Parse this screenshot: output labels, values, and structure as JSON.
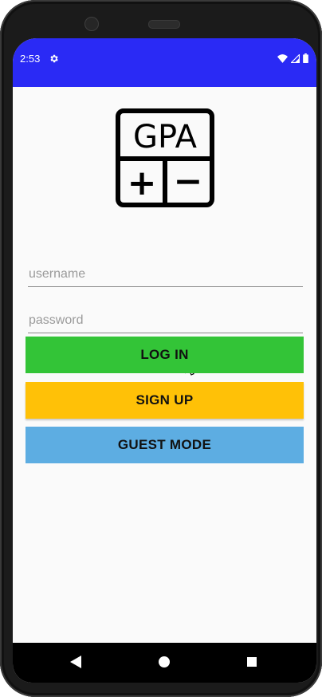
{
  "status_bar": {
    "time": "2:53"
  },
  "logo": {
    "text": "GPA",
    "plus": "+",
    "minus": "−"
  },
  "login_form": {
    "username_placeholder": "username",
    "password_placeholder": "password",
    "login_label": "LOG IN",
    "signup_label": "SIGN UP",
    "guest_label": "GUEST MODE"
  },
  "colors": {
    "status_bar": "#2a2af5",
    "login": "#33c437",
    "signup": "#ffc107",
    "guest": "#5dade2"
  }
}
